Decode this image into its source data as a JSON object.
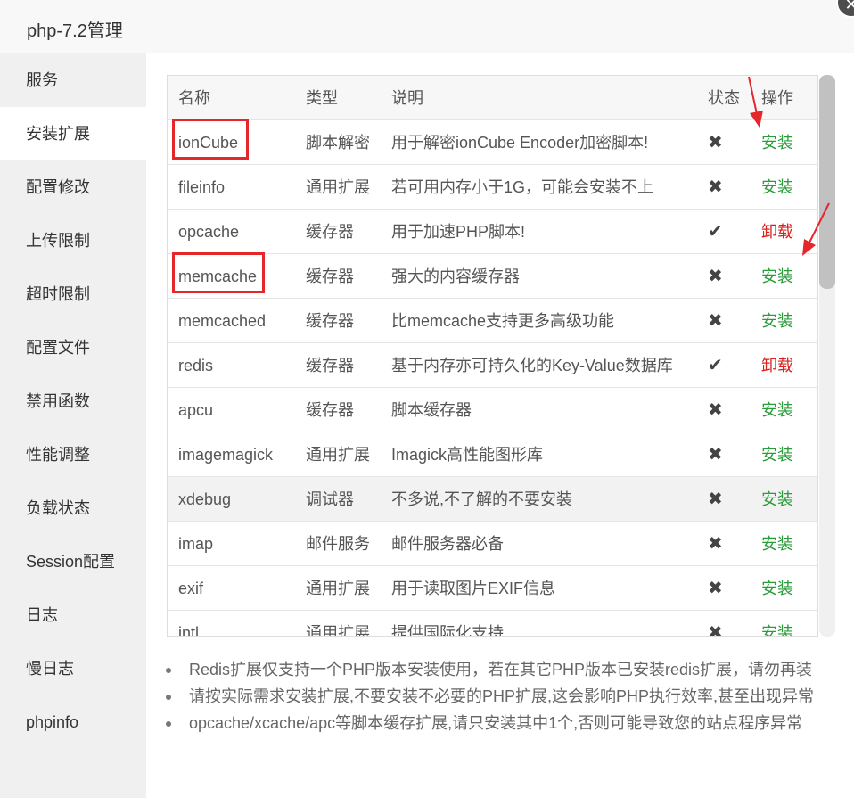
{
  "window": {
    "title": "php-7.2管理",
    "close_symbol": "✕"
  },
  "sidebar": {
    "items": [
      {
        "label": "服务"
      },
      {
        "label": "安装扩展",
        "active": true
      },
      {
        "label": "配置修改"
      },
      {
        "label": "上传限制"
      },
      {
        "label": "超时限制"
      },
      {
        "label": "配置文件"
      },
      {
        "label": "禁用函数"
      },
      {
        "label": "性能调整"
      },
      {
        "label": "负载状态"
      },
      {
        "label": "Session配置"
      },
      {
        "label": "日志"
      },
      {
        "label": "慢日志"
      },
      {
        "label": "phpinfo"
      }
    ]
  },
  "table": {
    "headers": {
      "name": "名称",
      "type": "类型",
      "desc": "说明",
      "status": "状态",
      "op": "操作"
    },
    "rows": [
      {
        "name": "ionCube",
        "type": "脚本解密",
        "desc": "用于解密ionCube Encoder加密脚本!",
        "status": "✖",
        "op": "安装",
        "installed": false
      },
      {
        "name": "fileinfo",
        "type": "通用扩展",
        "desc": "若可用内存小于1G，可能会安装不上",
        "status": "✖",
        "op": "安装",
        "installed": false
      },
      {
        "name": "opcache",
        "type": "缓存器",
        "desc": "用于加速PHP脚本!",
        "status": "✔",
        "op": "卸载",
        "installed": true
      },
      {
        "name": "memcache",
        "type": "缓存器",
        "desc": "强大的内容缓存器",
        "status": "✖",
        "op": "安装",
        "installed": false
      },
      {
        "name": "memcached",
        "type": "缓存器",
        "desc": "比memcache支持更多高级功能",
        "status": "✖",
        "op": "安装",
        "installed": false
      },
      {
        "name": "redis",
        "type": "缓存器",
        "desc": "基于内存亦可持久化的Key-Value数据库",
        "status": "✔",
        "op": "卸载",
        "installed": true
      },
      {
        "name": "apcu",
        "type": "缓存器",
        "desc": "脚本缓存器",
        "status": "✖",
        "op": "安装",
        "installed": false
      },
      {
        "name": "imagemagick",
        "type": "通用扩展",
        "desc": "Imagick高性能图形库",
        "status": "✖",
        "op": "安装",
        "installed": false
      },
      {
        "name": "xdebug",
        "type": "调试器",
        "desc": "不多说,不了解的不要安装",
        "status": "✖",
        "op": "安装",
        "installed": false
      },
      {
        "name": "imap",
        "type": "邮件服务",
        "desc": "邮件服务器必备",
        "status": "✖",
        "op": "安装",
        "installed": false
      },
      {
        "name": "exif",
        "type": "通用扩展",
        "desc": "用于读取图片EXIF信息",
        "status": "✖",
        "op": "安装",
        "installed": false
      },
      {
        "name": "intl",
        "type": "通用扩展",
        "desc": "提供国际化支持",
        "status": "✖",
        "op": "安装",
        "installed": false
      }
    ]
  },
  "notes": [
    "Redis扩展仅支持一个PHP版本安装使用，若在其它PHP版本已安装redis扩展，请勿再装",
    "请按实际需求安装扩展,不要安装不必要的PHP扩展,这会影响PHP执行效率,甚至出现异常",
    "opcache/xcache/apc等脚本缓存扩展,请只安装其中1个,否则可能导致您的站点程序异常"
  ],
  "colors": {
    "install": "#2a9d3b",
    "uninstall": "#d9231f",
    "annotation": "#e5262a"
  }
}
